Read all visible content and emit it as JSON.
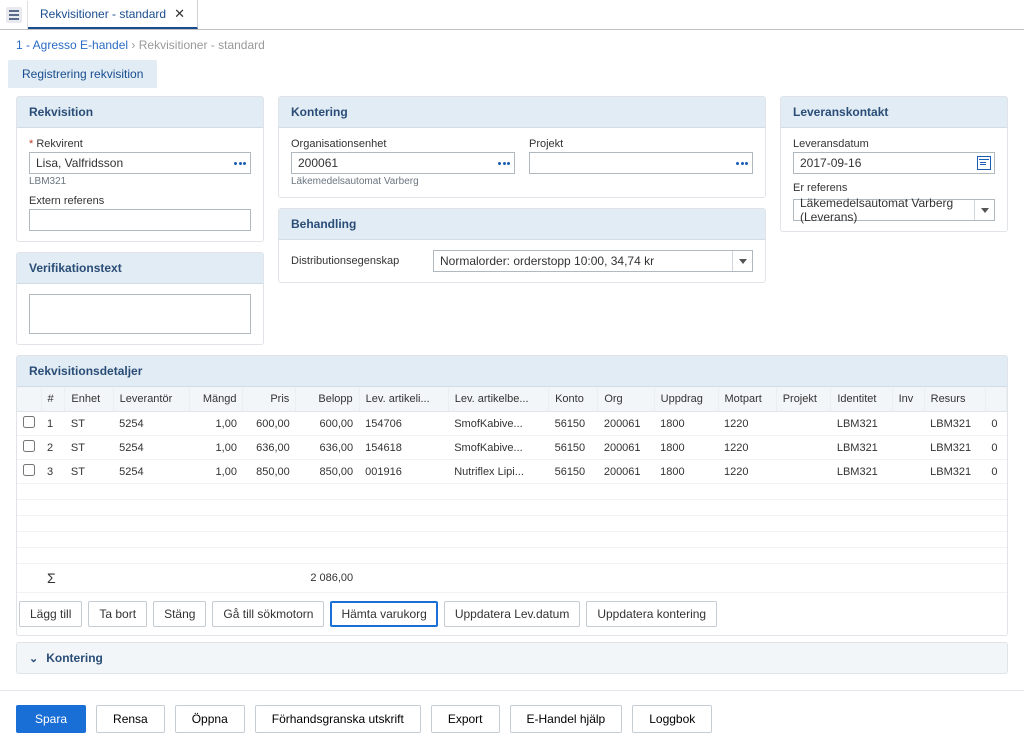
{
  "tab": {
    "title": "Rekvisitioner - standard"
  },
  "breadcrumb": {
    "link": "1 - Agresso E-handel",
    "current": "Rekvisitioner - standard"
  },
  "pagetab": "Registrering rekvisition",
  "rekvisition": {
    "header": "Rekvisition",
    "rekvirent_label": "Rekvirent",
    "rekvirent_value": "Lisa, Valfridsson",
    "rekvirent_hint": "LBM321",
    "extern_label": "Extern referens",
    "extern_value": ""
  },
  "verifikation": {
    "header": "Verifikationstext",
    "value": ""
  },
  "kontering": {
    "header": "Kontering",
    "org_label": "Organisationsenhet",
    "org_value": "200061",
    "org_hint": "Läkemedelsautomat Varberg",
    "projekt_label": "Projekt",
    "projekt_value": ""
  },
  "behandling": {
    "header": "Behandling",
    "dist_label": "Distributionsegenskap",
    "dist_value": "Normalorder: orderstopp 10:00, 34,74 kr"
  },
  "leverans": {
    "header": "Leveranskontakt",
    "datum_label": "Leveransdatum",
    "datum_value": "2017-09-16",
    "referens_label": "Er referens",
    "referens_value": "Läkemedelsautomat Varberg (Leverans)"
  },
  "details": {
    "header": "Rekvisitionsdetaljer",
    "columns": [
      "#",
      "Enhet",
      "Leverantör",
      "Mängd",
      "Pris",
      "Belopp",
      "Lev. artikeli...",
      "Lev. artikelbe...",
      "Konto",
      "Org",
      "Uppdrag",
      "Motpart",
      "Projekt",
      "Identitet",
      "Inv",
      "Resurs",
      ""
    ],
    "rows": [
      {
        "n": "1",
        "enhet": "ST",
        "lev": "5254",
        "mangd": "1,00",
        "pris": "600,00",
        "belopp": "600,00",
        "artid": "154706",
        "artbe": "SmofKabive...",
        "konto": "56150",
        "org": "200061",
        "uppdrag": "1800",
        "motpart": "1220",
        "projekt": "",
        "ident": "LBM321",
        "inv": "",
        "resurs": "LBM321",
        "tail": "0"
      },
      {
        "n": "2",
        "enhet": "ST",
        "lev": "5254",
        "mangd": "1,00",
        "pris": "636,00",
        "belopp": "636,00",
        "artid": "154618",
        "artbe": "SmofKabive...",
        "konto": "56150",
        "org": "200061",
        "uppdrag": "1800",
        "motpart": "1220",
        "projekt": "",
        "ident": "LBM321",
        "inv": "",
        "resurs": "LBM321",
        "tail": "0"
      },
      {
        "n": "3",
        "enhet": "ST",
        "lev": "5254",
        "mangd": "1,00",
        "pris": "850,00",
        "belopp": "850,00",
        "artid": "001916",
        "artbe": "Nutriflex Lipi...",
        "konto": "56150",
        "org": "200061",
        "uppdrag": "1800",
        "motpart": "1220",
        "projekt": "",
        "ident": "LBM321",
        "inv": "",
        "resurs": "LBM321",
        "tail": "0"
      }
    ],
    "sum_belopp": "2 086,00"
  },
  "table_buttons": {
    "add": "Lägg till",
    "remove": "Ta bort",
    "close": "Stäng",
    "search": "Gå till sökmotorn",
    "cart": "Hämta varukorg",
    "upd_date": "Uppdatera Lev.datum",
    "upd_kont": "Uppdatera kontering"
  },
  "accordion": {
    "label": "Kontering"
  },
  "footer": {
    "save": "Spara",
    "clear": "Rensa",
    "open": "Öppna",
    "preview": "Förhandsgranska utskrift",
    "export": "Export",
    "help": "E-Handel hjälp",
    "log": "Loggbok"
  }
}
